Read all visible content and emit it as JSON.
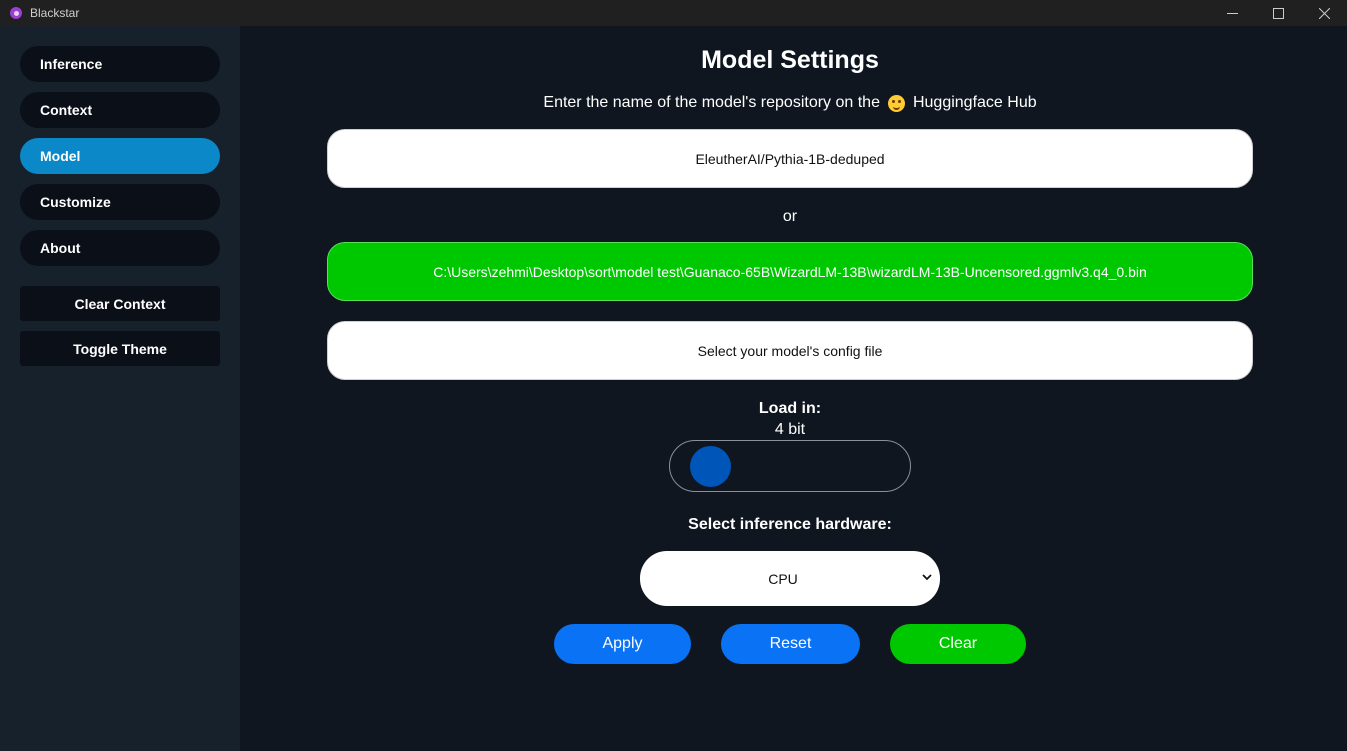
{
  "window": {
    "title": "Blackstar"
  },
  "sidebar": {
    "items": [
      {
        "label": "Inference"
      },
      {
        "label": "Context"
      },
      {
        "label": "Model",
        "active": true
      },
      {
        "label": "Customize"
      },
      {
        "label": "About"
      }
    ],
    "buttons": {
      "clear_context": "Clear Context",
      "toggle_theme": "Toggle Theme"
    }
  },
  "main": {
    "title": "Model Settings",
    "subtitle_before": "Enter the name of the model's repository on the",
    "subtitle_after": "Huggingface Hub",
    "repo_input_value": "EleutherAI/Pythia-1B-deduped",
    "or_text": "or",
    "model_file_path": "C:\\Users\\zehmi\\Desktop\\sort\\model test\\Guanaco-65B\\WizardLM-13B\\wizardLM-13B-Uncensored.ggmlv3.q4_0.bin",
    "config_file_button": "Select your model's config file",
    "load_in": {
      "label": "Load in:",
      "value": "4 bit",
      "slider_position": 0
    },
    "hardware": {
      "label": "Select inference hardware:",
      "selected": "CPU"
    },
    "actions": {
      "apply": "Apply",
      "reset": "Reset",
      "clear": "Clear"
    }
  },
  "colors": {
    "background": "#0f1620",
    "sidebar": "#17212c",
    "nav_item": "#0a0f18",
    "nav_active": "#0a88c8",
    "accent_blue": "#0a72f5",
    "accent_green": "#00c800"
  }
}
